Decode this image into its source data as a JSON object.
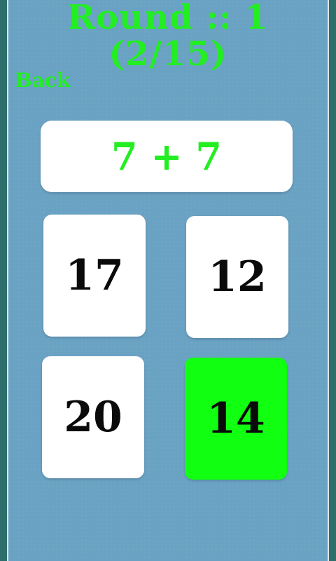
{
  "header": {
    "round_title": "Round :: 1",
    "progress": "(2/15)"
  },
  "nav": {
    "back_label": "Back"
  },
  "question": {
    "text": "7 + 7"
  },
  "answers": [
    {
      "label": "17",
      "highlighted": false
    },
    {
      "label": "12",
      "highlighted": false
    },
    {
      "label": "20",
      "highlighted": false
    },
    {
      "label": "14",
      "highlighted": true
    }
  ],
  "colors": {
    "accent_green": "#22ee22",
    "highlight_green": "#11ff11",
    "board_blue": "#6aa2c4",
    "frame_teal": "#2e6e6c"
  }
}
